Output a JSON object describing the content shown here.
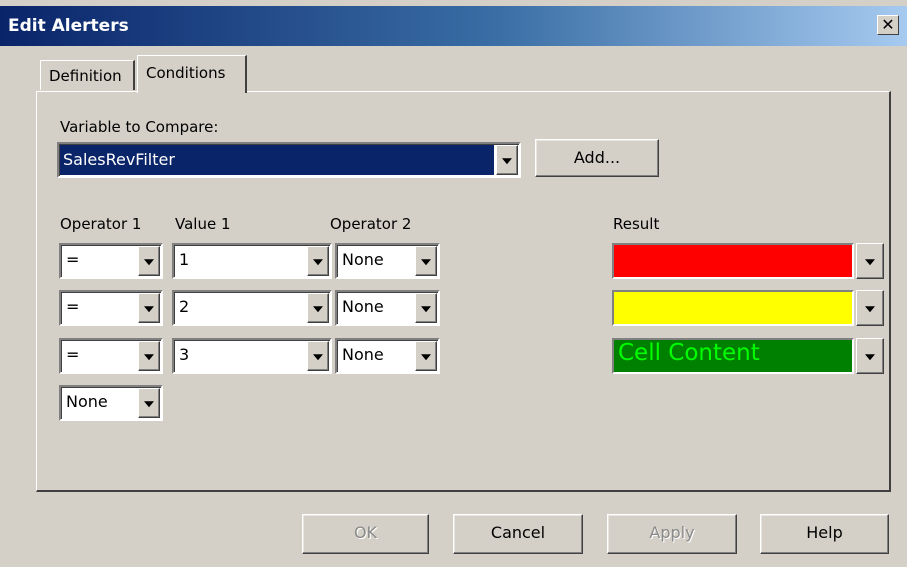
{
  "window": {
    "title": "Edit Alerters",
    "close_glyph": "✕"
  },
  "tabs": [
    {
      "label": "Definition",
      "active": false
    },
    {
      "label": "Conditions",
      "active": true
    }
  ],
  "variable": {
    "label": "Variable to Compare:",
    "value": "SalesRevFilter",
    "add_label": "Add..."
  },
  "headers": {
    "operator1": "Operator 1",
    "value1": "Value 1",
    "operator2": "Operator 2",
    "result": "Result"
  },
  "rows": [
    {
      "operator1": "=",
      "value1": "1",
      "operator2": "None"
    },
    {
      "operator1": "=",
      "value1": "2",
      "operator2": "None"
    },
    {
      "operator1": "=",
      "value1": "3",
      "operator2": "None"
    }
  ],
  "extra_operator": "None",
  "results": [
    {
      "text": "",
      "bg": "#ff0000",
      "fg": "#000000"
    },
    {
      "text": "",
      "bg": "#ffff00",
      "fg": "#000000"
    },
    {
      "text": "Cell Content",
      "bg": "#008000",
      "fg": "#00ff00"
    }
  ],
  "buttons": {
    "ok": "OK",
    "cancel": "Cancel",
    "apply": "Apply",
    "help": "Help"
  }
}
